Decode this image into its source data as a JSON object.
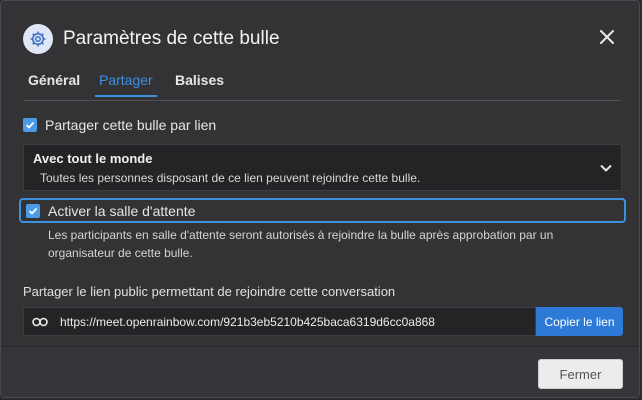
{
  "dialog": {
    "title": "Paramètres de cette bulle",
    "icon": "gear-icon",
    "close_icon": "close-icon"
  },
  "tabs": [
    {
      "label": "Général",
      "active": false
    },
    {
      "label": "Partager",
      "active": true
    },
    {
      "label": "Balises",
      "active": false
    }
  ],
  "share_by_link": {
    "checked": true,
    "label": "Partager cette bulle par lien"
  },
  "access_select": {
    "selected_title": "Avec tout le monde",
    "selected_description": "Toutes les personnes disposant de ce lien peuvent rejoindre cette bulle."
  },
  "waiting_room": {
    "checked": true,
    "label": "Activer la salle d'attente",
    "help": "Les participants en salle d'attente seront autorisés à rejoindre la bulle après approbation par un organisateur de cette bulle."
  },
  "public_link": {
    "label": "Partager le lien public permettant de rejoindre cette conversation",
    "url": "https://meet.openrainbow.com/921b3eb5210b425baca6319d6cc0a868",
    "copy_label": "Copier le lien",
    "icon": "link-icon"
  },
  "footer": {
    "close_label": "Fermer"
  },
  "colors": {
    "accent": "#3d8fe0",
    "primary_button": "#2c7ad6",
    "background": "#333336"
  }
}
